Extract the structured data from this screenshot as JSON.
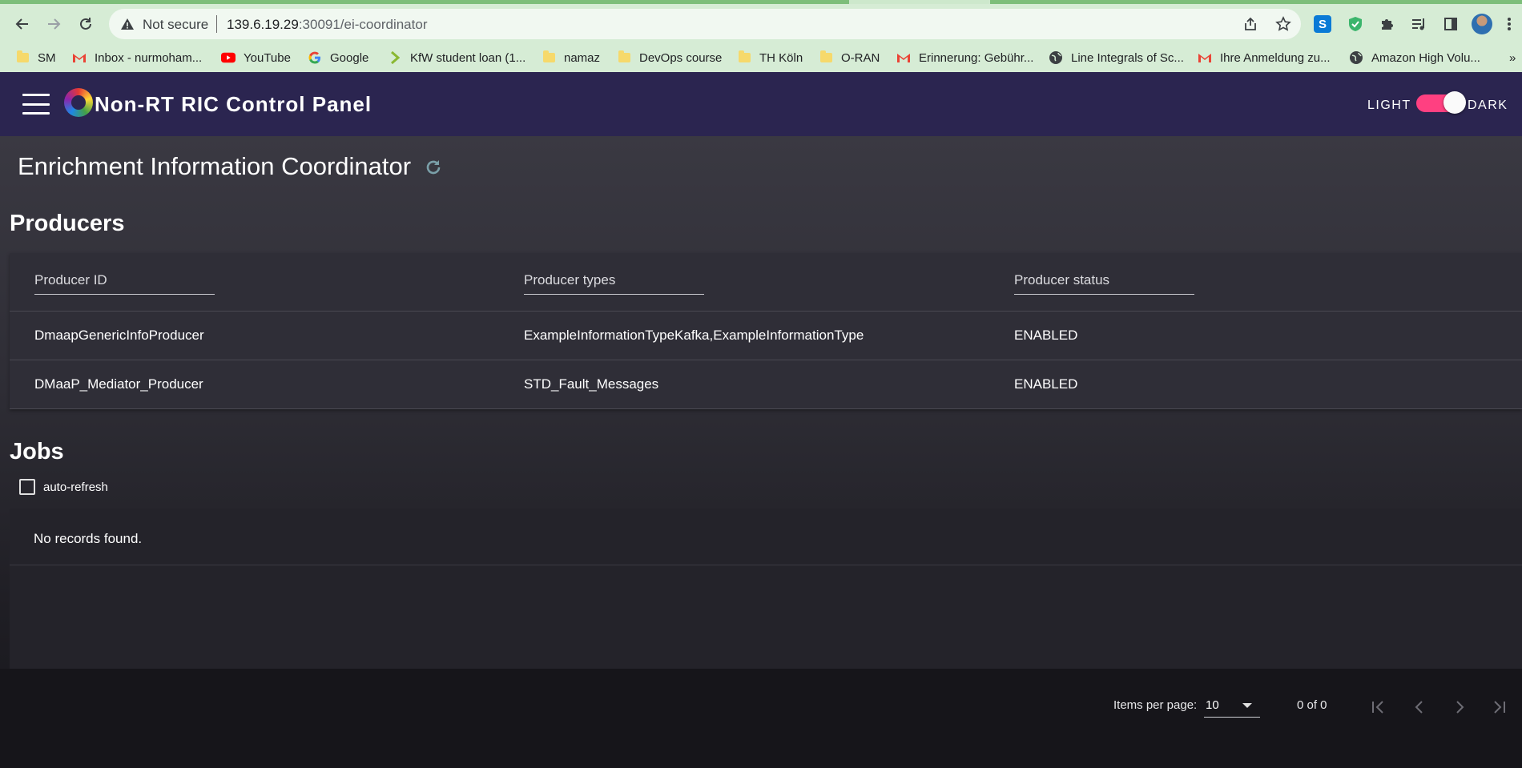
{
  "browser": {
    "security_label": "Not secure",
    "url_host": "139.6.19.29",
    "url_rest": ":30091/ei-coordinator",
    "bookmarks": [
      {
        "label": "SM",
        "icon": "folder-icon"
      },
      {
        "label": "Inbox - nurmoham...",
        "icon": "gmail-icon"
      },
      {
        "label": "YouTube",
        "icon": "youtube-icon"
      },
      {
        "label": "Google",
        "icon": "google-icon"
      },
      {
        "label": "KfW student loan (1...",
        "icon": "kfw-icon"
      },
      {
        "label": "namaz",
        "icon": "folder-icon"
      },
      {
        "label": "DevOps course",
        "icon": "folder-icon"
      },
      {
        "label": "TH Köln",
        "icon": "folder-icon"
      },
      {
        "label": "O-RAN",
        "icon": "folder-icon"
      },
      {
        "label": "Erinnerung: Gebühr...",
        "icon": "gmail-icon"
      },
      {
        "label": "Line Integrals of Sc...",
        "icon": "globe-icon"
      },
      {
        "label": "Ihre Anmeldung zu...",
        "icon": "gmail-icon"
      },
      {
        "label": "Amazon High Volu...",
        "icon": "globe-icon"
      }
    ],
    "more_bookmarks": "»"
  },
  "header": {
    "title": "Non-RT RIC Control Panel",
    "theme_light": "LIGHT",
    "theme_dark": "DARK",
    "dark_mode_on": true
  },
  "page": {
    "title": "Enrichment Information Coordinator"
  },
  "producers": {
    "title": "Producers",
    "columns": [
      "Producer ID",
      "Producer types",
      "Producer status"
    ],
    "rows": [
      [
        "DmaapGenericInfoProducer",
        "ExampleInformationTypeKafka,ExampleInformationType",
        "ENABLED"
      ],
      [
        "DMaaP_Mediator_Producer",
        "STD_Fault_Messages",
        "ENABLED"
      ]
    ]
  },
  "jobs": {
    "title": "Jobs",
    "auto_refresh_label": "auto-refresh",
    "auto_refresh_checked": false,
    "empty_message": "No records found."
  },
  "paginator": {
    "items_per_page_label": "Items per page:",
    "items_per_page": "10",
    "range": "0 of 0"
  },
  "colors": {
    "header_bg": "#2b2550",
    "toggle_accent": "#ff4081",
    "browser_toolbar": "#d6ecd5"
  }
}
